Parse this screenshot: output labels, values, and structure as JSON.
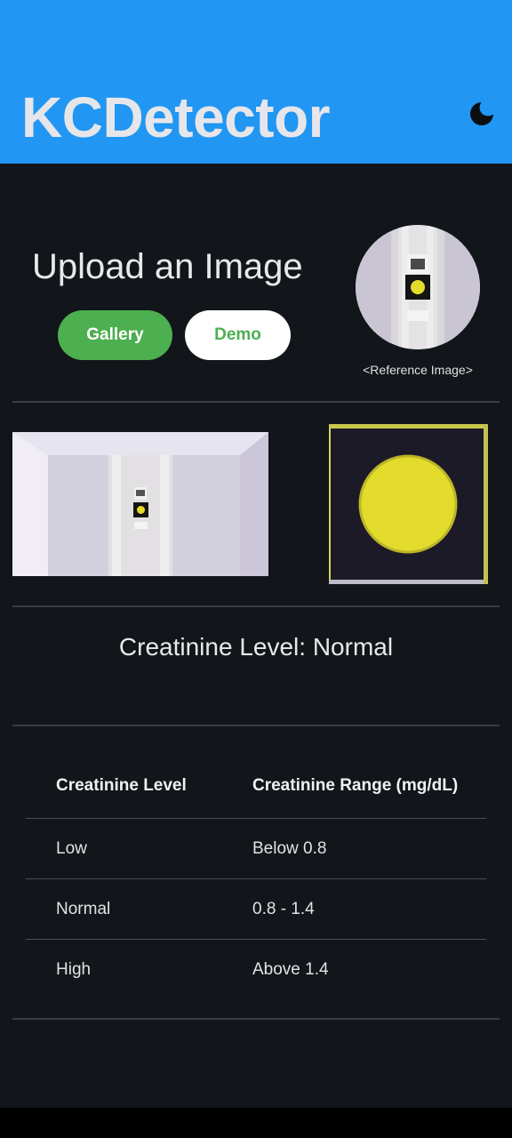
{
  "app": {
    "title": "KCDetector",
    "theme_icon": "moon-icon"
  },
  "colors": {
    "appbar": "#2196f3",
    "background": "#121519",
    "gallery_button": "#4caf50",
    "demo_button": "#ffffff",
    "strip_yellow": "#e4dc2c"
  },
  "upload": {
    "heading": "Upload an Image",
    "gallery_label": "Gallery",
    "demo_label": "Demo",
    "reference_caption": "<Reference Image>"
  },
  "result": {
    "text": "Creatinine Level: Normal"
  },
  "table": {
    "headers": [
      "Creatinine Level",
      "Creatinine Range (mg/dL)"
    ],
    "rows": [
      [
        "Low",
        "Below 0.8"
      ],
      [
        "Normal",
        "0.8 - 1.4"
      ],
      [
        "High",
        "Above 1.4"
      ]
    ]
  }
}
